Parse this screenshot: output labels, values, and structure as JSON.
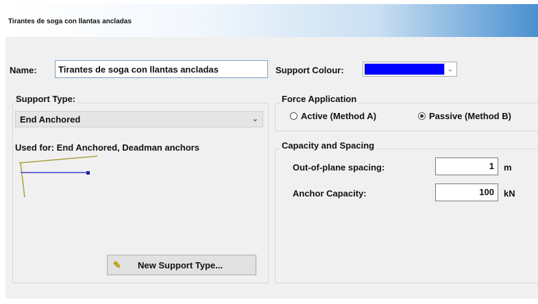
{
  "window": {
    "title": "Tirantes de soga con llantas ancladas"
  },
  "name_field": {
    "label": "Name:",
    "value": "Tirantes de soga con llantas ancladas"
  },
  "support_colour": {
    "label": "Support Colour:",
    "color": "#0000ff"
  },
  "support_type": {
    "group_label": "Support Type:",
    "selected": "End Anchored",
    "used_for": "Used for: End Anchored, Deadman anchors",
    "new_button": "New Support Type..."
  },
  "force_application": {
    "group_label": "Force Application",
    "options": [
      {
        "label": "Active (Method A)",
        "selected": false
      },
      {
        "label": "Passive (Method B)",
        "selected": true
      }
    ]
  },
  "capacity": {
    "group_label": "Capacity and Spacing",
    "spacing": {
      "label": "Out-of-plane spacing:",
      "value": "1",
      "unit": "m"
    },
    "anchor": {
      "label": "Anchor Capacity:",
      "value": "100",
      "unit": "kN"
    }
  },
  "icons": {
    "chevron": "chevron-down-icon",
    "new_support": "pencil-icon",
    "preview": "anchor-preview-icon"
  },
  "colors": {
    "accent": "#4a90d0",
    "anchor_line": "#4040d0",
    "wall_line": "#a8a040"
  }
}
